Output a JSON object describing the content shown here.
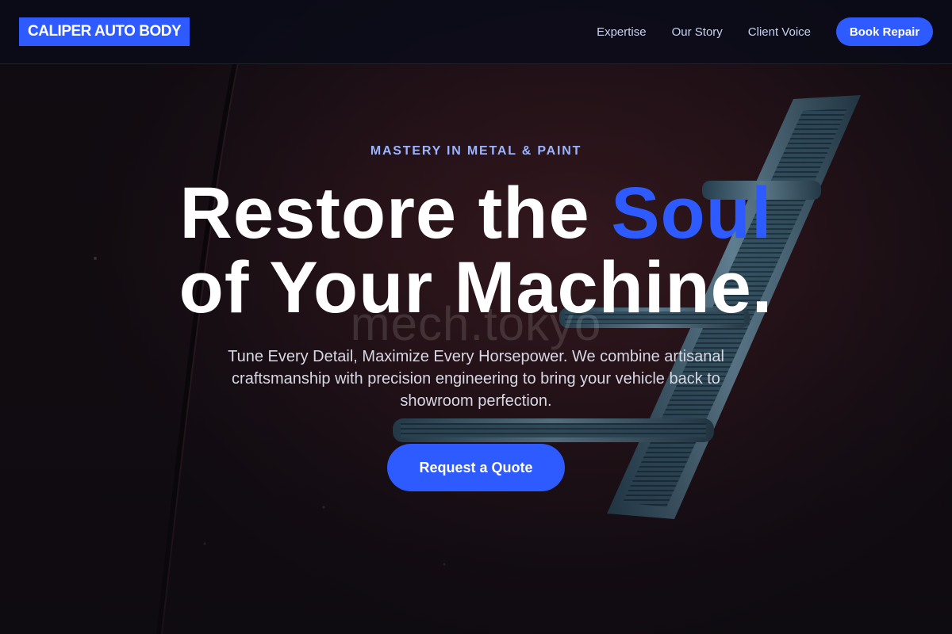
{
  "header": {
    "brand": "CALIPER AUTO BODY",
    "nav_links": [
      "Expertise",
      "Our Story",
      "Client Voice"
    ],
    "cta_label": "Book Repair"
  },
  "hero": {
    "eyebrow": "MASTERY IN METAL & PAINT",
    "headline_part1": "Restore the ",
    "headline_accent": "Soul",
    "headline_line2": "of Your Machine.",
    "watermark": "mech.tokyo",
    "subtitle": "Tune Every Detail, Maximize Every Horsepower. We combine artisanal craftsmanship with precision engineering to bring your vehicle back to showroom perfection.",
    "cta_label": "Request a Quote",
    "background_image": "dark red car body with chrome fender emblem"
  },
  "colors": {
    "accent": "#2e5bff",
    "eyebrow": "#9cb4ff",
    "nav_text": "#c9d2f2",
    "navbar_bg": "#0a0c18"
  }
}
